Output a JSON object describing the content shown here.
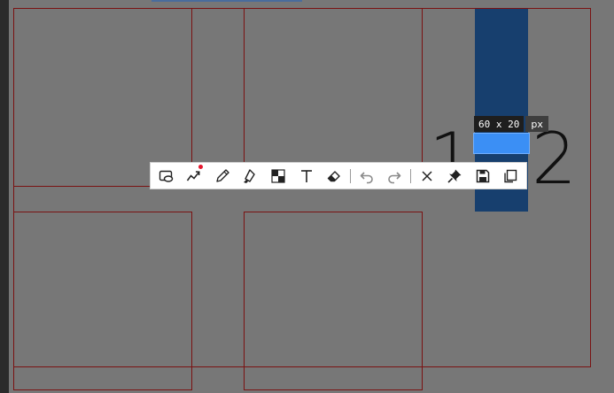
{
  "selection": {
    "size_text": "60 x 20",
    "unit": "px"
  },
  "labels": {
    "one": "1",
    "two": "2"
  },
  "toolbar": {
    "items": [
      {
        "name": "rectangle-tool",
        "icon": "rectangle-ellipse-icon"
      },
      {
        "name": "polyline-tool",
        "icon": "polyline-icon",
        "indicator": "red-dot"
      },
      {
        "name": "pencil-tool",
        "icon": "pencil-icon"
      },
      {
        "name": "marker-tool",
        "icon": "highlighter-icon"
      },
      {
        "name": "mosaic-tool",
        "icon": "mosaic-icon"
      },
      {
        "name": "text-tool",
        "icon": "text-icon"
      },
      {
        "name": "eraser-tool",
        "icon": "eraser-icon"
      },
      {
        "name": "undo-button",
        "icon": "undo-icon"
      },
      {
        "name": "redo-button",
        "icon": "redo-icon"
      },
      {
        "name": "close-button",
        "icon": "close-icon"
      },
      {
        "name": "pin-button",
        "icon": "pin-icon"
      },
      {
        "name": "save-button",
        "icon": "save-icon"
      },
      {
        "name": "copy-button",
        "icon": "copy-icon"
      }
    ]
  },
  "colors": {
    "canvas": "#777777",
    "frame_lines": "#7a1212",
    "blue_column": "#173f6e",
    "selection": "#3b8ff5",
    "indicator": "#e5162d"
  }
}
